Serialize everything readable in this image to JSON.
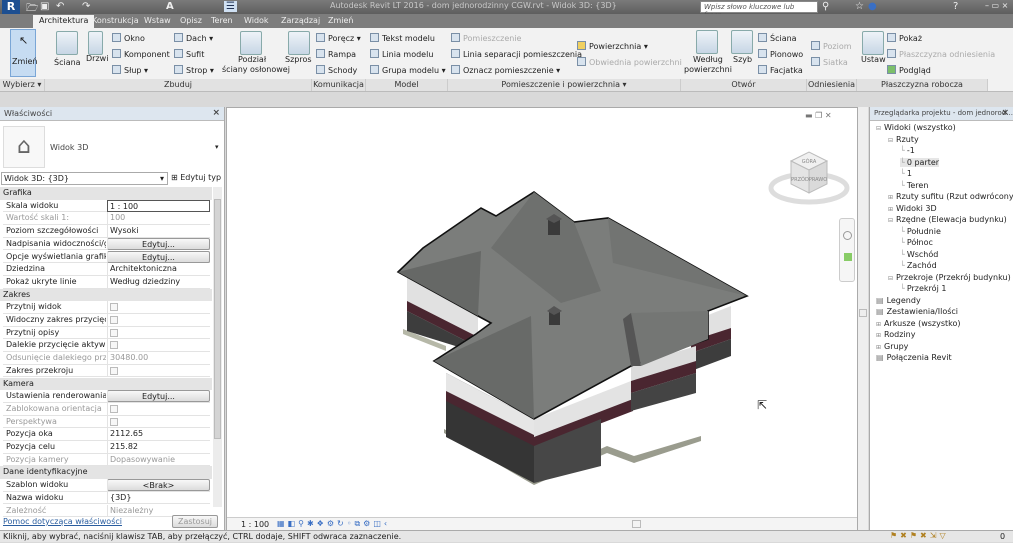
{
  "app": {
    "title": "Autodesk Revit LT 2016 -   dom jednorodzinny CGW.rvt - Widok 3D: {3D}",
    "search_placeholder": "Wpisz słowo kluczowe lub frazę"
  },
  "tabs": [
    "Architektura",
    "Konstrukcja",
    "Wstaw",
    "Opisz",
    "Teren",
    "Widok",
    "Zarządzaj",
    "Zmień"
  ],
  "ribbon": {
    "groups": [
      "Wybierz",
      "Zbuduj",
      "Komunikacja",
      "Model",
      "Pomieszczenie i powierzchnia",
      "Otwór",
      "Odniesienia",
      "Płaszczyzna robocza"
    ],
    "modify": "Zmień",
    "wall": "Ściana",
    "door": "Drzwi",
    "window": "Okno",
    "component": "Komponent",
    "column": "Słup",
    "roof": "Dach",
    "ceiling": "Sufit",
    "floor": "Strop",
    "curtain_grid_1": "Podział",
    "curtain_grid_2": "ściany osłonowej",
    "mullion": "Szpros",
    "railing": "Poręcz",
    "ramp": "Rampa",
    "stair": "Schody",
    "model_text": "Tekst modelu",
    "model_line": "Linia modelu",
    "model_group": "Grupa modelu",
    "room": "Pomieszczenie",
    "room_sep": "Linia separacji  pomieszczenia",
    "tag_room": "Oznacz  pomieszczenie",
    "area": "Powierzchnia",
    "area_boundary": "Obwiednia  powierzchni",
    "by_face_1": "Według",
    "by_face_2": "powierzchni",
    "shaft": "Szyb",
    "wall_op": "Ściana",
    "vertical": "Pionowo",
    "dormer": "Facjatka",
    "level": "Poziom",
    "grid": "Siatka",
    "set": "Ustaw",
    "show": "Pokaż",
    "ref_plane": "Płaszczyzna odniesienia",
    "viewer": "Podgląd"
  },
  "properties": {
    "title": "Właściwości",
    "type_name": "Widok 3D",
    "selector": "Widok 3D: {3D}",
    "edit_type": "Edytuj typ",
    "sections": [
      {
        "name": "Grafika",
        "rows": [
          {
            "k": "Skala widoku",
            "v": "1 : 100",
            "kind": "input"
          },
          {
            "k": "Wartość skali   1:",
            "v": "100",
            "kind": "dis"
          },
          {
            "k": "Poziom szczegółowości",
            "v": "Wysoki"
          },
          {
            "k": "Nadpisania widoczności/g...",
            "v": "Edytuj...",
            "kind": "btn"
          },
          {
            "k": "Opcje wyświetlania grafiki",
            "v": "Edytuj...",
            "kind": "btn"
          },
          {
            "k": "Dziedzina",
            "v": "Architektoniczna"
          },
          {
            "k": "Pokaż ukryte linie",
            "v": "Według dziedziny"
          }
        ]
      },
      {
        "name": "Zakres",
        "rows": [
          {
            "k": "Przytnij widok",
            "v": "",
            "kind": "chk"
          },
          {
            "k": "Widoczny zakres przycięcia",
            "v": "",
            "kind": "chk"
          },
          {
            "k": "Przytnij opisy",
            "v": "",
            "kind": "chk"
          },
          {
            "k": "Dalekie przycięcie aktywne",
            "v": "",
            "kind": "chk"
          },
          {
            "k": "Odsunięcie dalekiego przy...",
            "v": "30480.00",
            "kind": "dis"
          },
          {
            "k": "Zakres przekroju",
            "v": "",
            "kind": "chk"
          }
        ]
      },
      {
        "name": "Kamera",
        "rows": [
          {
            "k": "Ustawienia renderowania",
            "v": "Edytuj...",
            "kind": "btn"
          },
          {
            "k": "Zablokowana orientacja",
            "v": "",
            "kind": "dischk"
          },
          {
            "k": "Perspektywa",
            "v": "",
            "kind": "dischk"
          },
          {
            "k": "Pozycja oka",
            "v": "2112.65"
          },
          {
            "k": "Pozycja celu",
            "v": "215.82"
          },
          {
            "k": "Pozycja kamery",
            "v": "Dopasowywanie",
            "kind": "dis"
          }
        ]
      },
      {
        "name": "Dane identyfikacyjne",
        "rows": [
          {
            "k": "Szablon widoku",
            "v": "<Brak>",
            "kind": "btn"
          },
          {
            "k": "Nazwa widoku",
            "v": "{3D}"
          },
          {
            "k": "Zależność",
            "v": "Niezależny",
            "kind": "dis"
          }
        ]
      }
    ],
    "help": "Pomoc dotycząca właściwości",
    "apply": "Zastosuj"
  },
  "view": {
    "scale": "1 : 100",
    "viewcube": {
      "top": "GÓRA",
      "front": "PRZÓD",
      "right": "PRAWO"
    }
  },
  "browser": {
    "title": "Przeglądarka projektu - dom jednorod...",
    "nodes": [
      {
        "t": "Widoki (wszystko)",
        "d": 0,
        "s": "−"
      },
      {
        "t": "Rzuty",
        "d": 1,
        "s": "−"
      },
      {
        "t": "-1",
        "d": 2
      },
      {
        "t": "0 parter",
        "d": 2,
        "sel": true
      },
      {
        "t": "1",
        "d": 2
      },
      {
        "t": "Teren",
        "d": 2
      },
      {
        "t": "Rzuty sufitu (Rzut odwrócony)",
        "d": 1,
        "s": "+"
      },
      {
        "t": "Widoki 3D",
        "d": 1,
        "s": "+"
      },
      {
        "t": "Rzędne (Elewacja budynku)",
        "d": 1,
        "s": "−"
      },
      {
        "t": "Południe",
        "d": 2
      },
      {
        "t": "Północ",
        "d": 2
      },
      {
        "t": "Wschód",
        "d": 2
      },
      {
        "t": "Zachód",
        "d": 2
      },
      {
        "t": "Przekroje (Przekrój budynku)",
        "d": 1,
        "s": "−"
      },
      {
        "t": "Przekrój 1",
        "d": 2
      },
      {
        "t": "Legendy",
        "d": 0
      },
      {
        "t": "Zestawienia/Ilości",
        "d": 0
      },
      {
        "t": "Arkusze (wszystko)",
        "d": 0,
        "s": "+"
      },
      {
        "t": "Rodziny",
        "d": 0,
        "s": "+"
      },
      {
        "t": "Grupy",
        "d": 0,
        "s": "+"
      },
      {
        "t": "Połączenia Revit",
        "d": 0
      }
    ]
  },
  "status": {
    "text": "Kliknij, aby wybrać, naciśnij klawisz TAB, aby przełączyć, CTRL dodaje, SHIFT odwraca zaznaczenie.",
    "filter_count": "0"
  },
  "colors": {
    "accent": "#2a5d9f",
    "selected_tool": "#c6dcf2"
  }
}
